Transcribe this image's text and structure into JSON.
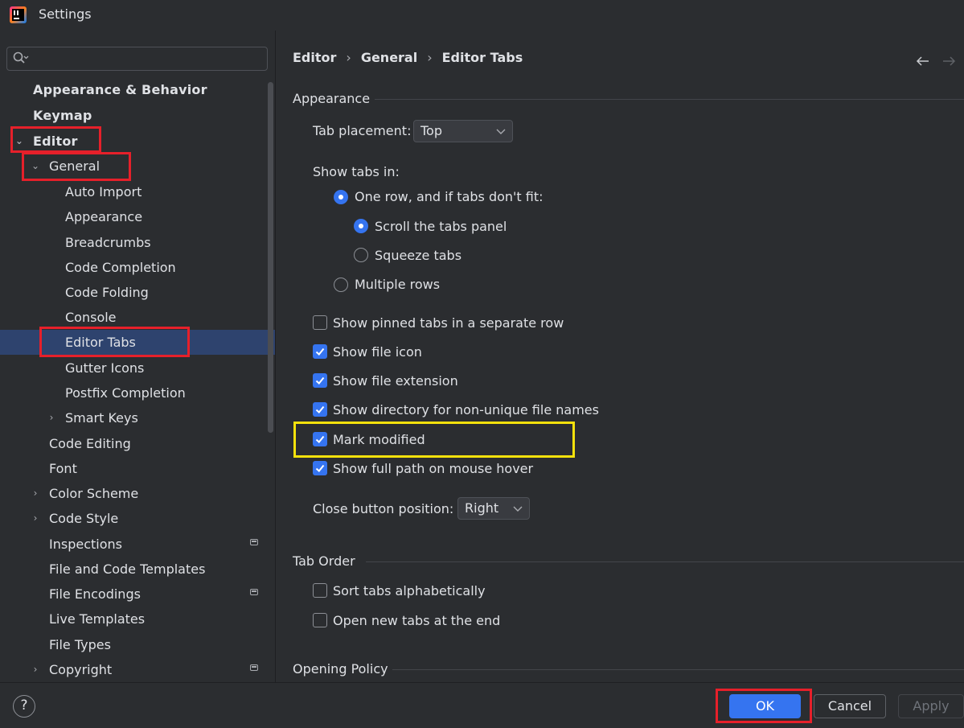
{
  "window": {
    "title": "Settings"
  },
  "search": {
    "placeholder": ""
  },
  "sidebar": {
    "items": [
      {
        "label": "Appearance & Behavior"
      },
      {
        "label": "Keymap"
      },
      {
        "label": "Editor",
        "expanded": true
      },
      {
        "label": "General",
        "expanded": true
      },
      {
        "label": "Auto Import"
      },
      {
        "label": "Appearance"
      },
      {
        "label": "Breadcrumbs"
      },
      {
        "label": "Code Completion"
      },
      {
        "label": "Code Folding"
      },
      {
        "label": "Console"
      },
      {
        "label": "Editor Tabs",
        "selected": true
      },
      {
        "label": "Gutter Icons"
      },
      {
        "label": "Postfix Completion"
      },
      {
        "label": "Smart Keys",
        "expandable": true
      },
      {
        "label": "Code Editing"
      },
      {
        "label": "Font"
      },
      {
        "label": "Color Scheme",
        "expandable": true
      },
      {
        "label": "Code Style",
        "expandable": true
      },
      {
        "label": "Inspections",
        "badge": true
      },
      {
        "label": "File and Code Templates"
      },
      {
        "label": "File Encodings",
        "badge": true
      },
      {
        "label": "Live Templates"
      },
      {
        "label": "File Types"
      },
      {
        "label": "Copyright",
        "expandable": true,
        "badge": true
      }
    ]
  },
  "breadcrumb": {
    "items": [
      "Editor",
      "General",
      "Editor Tabs"
    ],
    "separator": "›"
  },
  "content": {
    "appearance": {
      "title": "Appearance",
      "tab_placement_label": "Tab placement:",
      "tab_placement_value": "Top",
      "show_tabs_in_label": "Show tabs in:",
      "radio_one_row": {
        "label": "One row, and if tabs don't fit:",
        "selected": true
      },
      "radio_scroll": {
        "label": "Scroll the tabs panel",
        "selected": true
      },
      "radio_squeeze": {
        "label": "Squeeze tabs",
        "selected": false
      },
      "radio_multiple": {
        "label": "Multiple rows",
        "selected": false
      },
      "checkboxes": [
        {
          "label": "Show pinned tabs in a separate row",
          "checked": false
        },
        {
          "label": "Show file icon",
          "checked": true
        },
        {
          "label": "Show file extension",
          "checked": true
        },
        {
          "label": "Show directory for non-unique file names",
          "checked": true
        },
        {
          "label": "Mark modified",
          "checked": true
        },
        {
          "label": "Show full path on mouse hover",
          "checked": true
        }
      ],
      "close_button_label": "Close button position:",
      "close_button_value": "Right"
    },
    "tab_order": {
      "title": "Tab Order",
      "checkboxes": [
        {
          "label": "Sort tabs alphabetically",
          "checked": false
        },
        {
          "label": "Open new tabs at the end",
          "checked": false
        }
      ]
    },
    "opening_policy": {
      "title": "Opening Policy"
    }
  },
  "footer": {
    "help": "?",
    "ok": "OK",
    "cancel": "Cancel",
    "apply": "Apply"
  },
  "colors": {
    "accent": "#3574f0",
    "selection": "#2e436e",
    "highlight_red": "#e6202a",
    "highlight_yellow": "#f5e10c",
    "background": "#2b2d30"
  },
  "icons": {
    "app": "intellij-logo-icon",
    "search": "search-icon",
    "back": "arrow-left-icon",
    "forward": "arrow-right-icon",
    "help": "help-icon"
  }
}
